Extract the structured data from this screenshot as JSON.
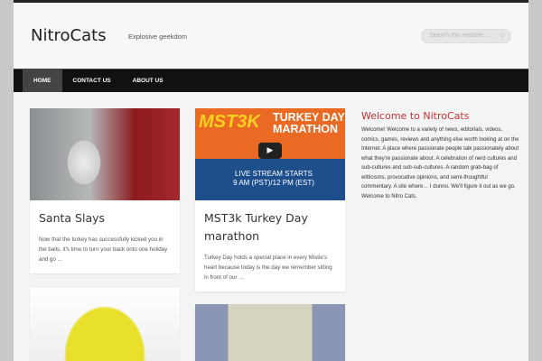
{
  "site": {
    "title": "NitroCats",
    "tagline": "Explosive geekdom",
    "search_placeholder": "Search this website..."
  },
  "nav": [
    {
      "label": "HOME"
    },
    {
      "label": "CONTACT US"
    },
    {
      "label": "ABOUT US"
    }
  ],
  "posts": [
    {
      "title": "Santa Slays",
      "excerpt": "Now that the turkey has successfully kicked you in the balls, it's time to turn your back onto one holiday and go …"
    },
    {
      "title": "MST3k Turkey Day marathon",
      "excerpt": "Turkey Day holds a special place in every Mistie's heart because today is the day we remember sitting in front of our …",
      "image_text": {
        "logo": "MST3K",
        "headline": "TURKEY DAY MARATHON",
        "line1": "LIVE STREAM STARTS",
        "line2": "9 AM (PST)/12 PM (EST)"
      }
    },
    {
      "title": ""
    },
    {
      "title": ""
    }
  ],
  "sidebar": {
    "title": "Welcome to NitroCats",
    "text": "Welcome! Welcome to a variety of news, editorials, videos, comics, games, reviews and anything else worth looking at on the Internet. A place where passionate people talk passionately about what they're passionate about. A celebration of nerd cultures and sub-cultures and sub-sub-cultures. A random grab-bag of witticisms, provocative opinions, and semi-thoughtful commentary. A site where… I dunno. We'll figure it out as we go. Welcome to Nitro Cats."
  },
  "colors": {
    "accent": "#c8323b",
    "nav": "#111111"
  }
}
